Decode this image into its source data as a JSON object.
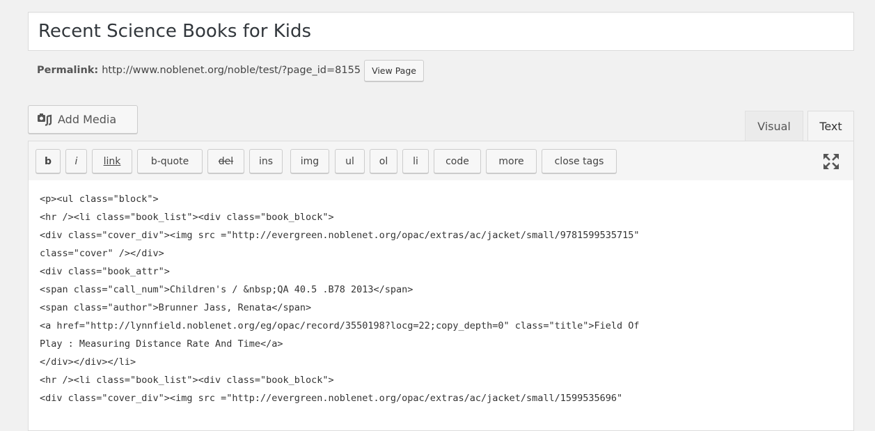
{
  "post_title": "Recent Science Books for Kids",
  "permalink": {
    "label": "Permalink:",
    "url": "http://www.noblenet.org/noble/test/?page_id=8155",
    "view_button": "View Page"
  },
  "media": {
    "add_media_label": "Add Media",
    "icon": "media-icon"
  },
  "tabs": {
    "visual": "Visual",
    "text": "Text",
    "active": "Text"
  },
  "quicktags": [
    "b",
    "i",
    "link",
    "b-quote",
    "del",
    "ins",
    "img",
    "ul",
    "ol",
    "li",
    "code",
    "more",
    "close tags"
  ],
  "fullscreen_icon": "fullscreen-icon",
  "editor_lines": [
    "<p><ul class=\"block\">",
    "<hr /><li class=\"book_list\"><div class=\"book_block\">",
    "<div class=\"cover_div\"><img src =\"http://evergreen.noblenet.org/opac/extras/ac/jacket/small/9781599535715\"",
    "class=\"cover\" /></div>",
    "<div class=\"book_attr\">",
    "<span class=\"call_num\">Children's / &nbsp;QA 40.5 .B78 2013</span>",
    "<span class=\"author\">Brunner Jass, Renata</span>",
    "<a href=\"http://lynnfield.noblenet.org/eg/opac/record/3550198?locg=22;copy_depth=0\" class=\"title\">Field Of",
    "Play : Measuring Distance Rate And Time</a>",
    "</div></div></li>",
    "<hr /><li class=\"book_list\"><div class=\"book_block\">",
    "<div class=\"cover_div\"><img src =\"http://evergreen.noblenet.org/opac/extras/ac/jacket/small/1599535696\""
  ]
}
